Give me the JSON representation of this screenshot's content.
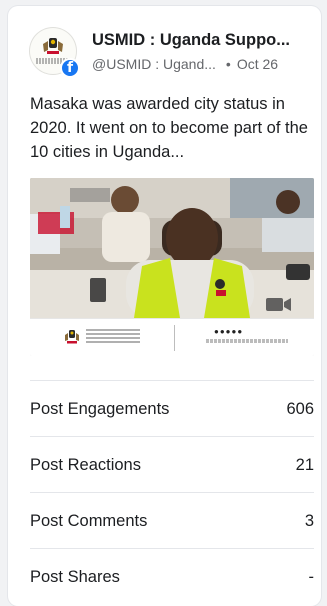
{
  "post": {
    "page_name": "USMID : Uganda Suppo...",
    "handle": "@USMID : Ugand...",
    "separator": "•",
    "date": "Oct 26",
    "text": "Masaka was awarded city status in 2020. It went on to become part of the 10 cities in Uganda..."
  },
  "media": {
    "banner_icons": "●●●●●",
    "type": "video"
  },
  "stats": [
    {
      "label": "Post Engagements",
      "value": "606"
    },
    {
      "label": "Post Reactions",
      "value": "21"
    },
    {
      "label": "Post Comments",
      "value": "3"
    },
    {
      "label": "Post Shares",
      "value": "-"
    }
  ],
  "colors": {
    "facebook_blue": "#1877f2",
    "vest_yellow": "#c9e21e",
    "muted_text": "#65676b"
  }
}
